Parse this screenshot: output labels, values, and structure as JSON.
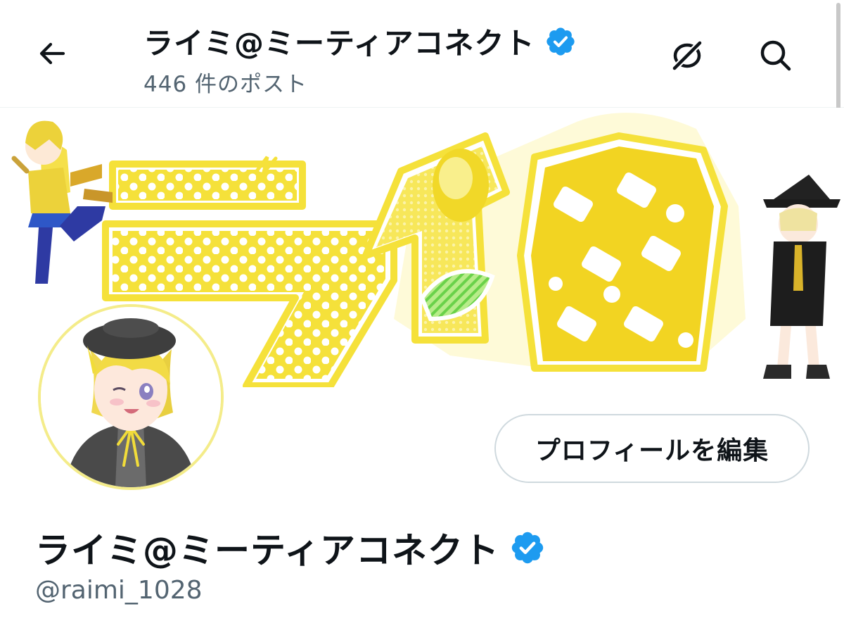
{
  "header": {
    "title": "ライミ@ミーティアコネクト",
    "post_count": "446 件のポスト",
    "icons": [
      "back-arrow-icon",
      "verified-badge-icon",
      "link-off-icon",
      "search-icon"
    ]
  },
  "profile": {
    "display_name": "ライミ@ミーティアコネクト",
    "handle": "@raimi_1028",
    "edit_button_label": "プロフィールを編集"
  },
  "colors": {
    "verified": "#1d9bf0",
    "text_primary": "#0f1419",
    "text_secondary": "#536471",
    "banner_yellow": "#f5e13a",
    "border": "#cfd9de"
  }
}
